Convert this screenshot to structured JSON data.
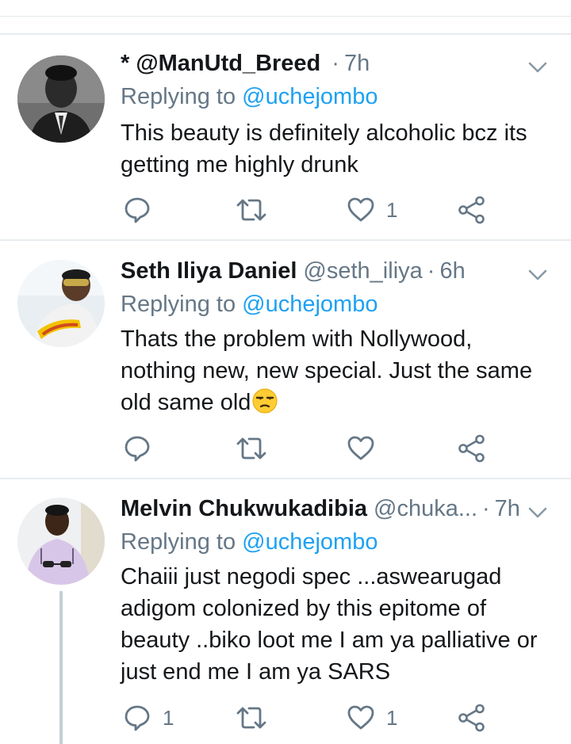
{
  "tweets": [
    {
      "name": "* @ManUtd_Breed",
      "handle": "",
      "time": "7h",
      "reply_prefix": "Replying to",
      "reply_to": "@uchejombo",
      "lines": [
        "This beauty is definitely alcoholic bcz its",
        "getting me highly drunk"
      ],
      "reply_count": "",
      "retweet_count": "",
      "like_count": "1"
    },
    {
      "name": "Seth Iliya Daniel",
      "handle": "@seth_iliya",
      "time": "6h",
      "reply_prefix": "Replying to",
      "reply_to": "@uchejombo",
      "lines": [
        "Thats the problem with Nollywood,",
        "nothing new, new special. Just the same",
        "old same old"
      ],
      "emoji": "unamused-face-emoji",
      "reply_count": "",
      "retweet_count": "",
      "like_count": ""
    },
    {
      "name": "Melvin Chukwukadibia",
      "handle": "@chuka...",
      "time": "7h",
      "reply_prefix": "Replying to",
      "reply_to": "@uchejombo",
      "lines": [
        "Chaiii just negodi spec ...aswearugad",
        "adigom colonized by this epitome of",
        "beauty ..biko loot me I am ya palliative or",
        "just end me I am ya SARS"
      ],
      "reply_count": "1",
      "retweet_count": "",
      "like_count": "1"
    }
  ],
  "colors": {
    "text": "#14171a",
    "secondary": "#657786",
    "link": "#1da1f2",
    "divider": "#e6ecf0",
    "thread_line": "#c4cfd6"
  },
  "icons": [
    "reply-icon",
    "retweet-icon",
    "like-icon",
    "share-icon",
    "chevron-down-icon"
  ]
}
